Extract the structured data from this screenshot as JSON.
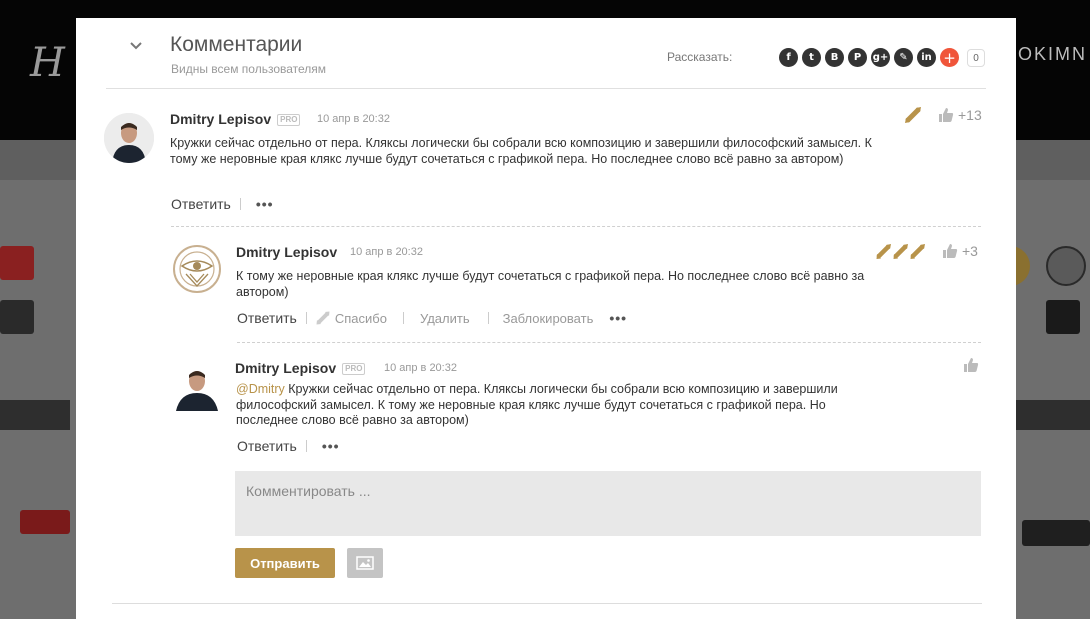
{
  "header": {
    "title": "Комментарии",
    "subtitle": "Видны всем пользователям",
    "share_label": "Рассказать:",
    "share_count": "0",
    "share_icons": [
      {
        "name": "facebook-icon",
        "glyph": "f"
      },
      {
        "name": "twitter-icon",
        "glyph": "t"
      },
      {
        "name": "vkontakte-icon",
        "glyph": "B"
      },
      {
        "name": "pinterest-icon",
        "glyph": "P"
      },
      {
        "name": "google-plus-icon",
        "glyph": "g+"
      },
      {
        "name": "livejournal-icon",
        "glyph": "✎"
      },
      {
        "name": "linkedin-icon",
        "glyph": "in"
      },
      {
        "name": "more-share-icon",
        "glyph": "+"
      }
    ]
  },
  "comments": [
    {
      "author": "Dmitry Lepisov",
      "pro": "PRO",
      "date": "10 апр в 20:32",
      "text": "Кружки сейчас отдельно от пера. Кляксы логически бы собрали всю композицию и завершили философский замысел. К тому же неровные края клякс лучше будут сочетаться с графикой пера. Но последнее слово всё равно за автором)",
      "reply": "Ответить",
      "more": "•••",
      "score": "+13"
    },
    {
      "author": "Dmitry Lepisov",
      "date": "10 апр в 20:32",
      "text": "К тому же неровные края клякс лучше будут сочетаться с графикой пера. Но последнее слово всё равно за автором)",
      "reply": "Ответить",
      "thanks": "Спасибо",
      "delete": "Удалить",
      "block": "Заблокировать",
      "more": "•••",
      "score": "+3"
    },
    {
      "author": "Dmitry Lepisov",
      "pro": "PRO",
      "date": "10 апр в 20:32",
      "mention": "@Dmitry",
      "text": " Кружки сейчас отдельно от пера. Кляксы логически бы собрали всю композицию и завершили философский замысел. К тому же неровные края клякс лучше будут сочетаться с графикой пера. Но последнее слово всё равно за автором)",
      "reply": "Ответить",
      "more": "•••"
    }
  ],
  "form": {
    "placeholder": "Комментировать ...",
    "submit": "Отправить"
  },
  "colors": {
    "accent": "#b8934a",
    "share_plus": "#f0553a"
  }
}
